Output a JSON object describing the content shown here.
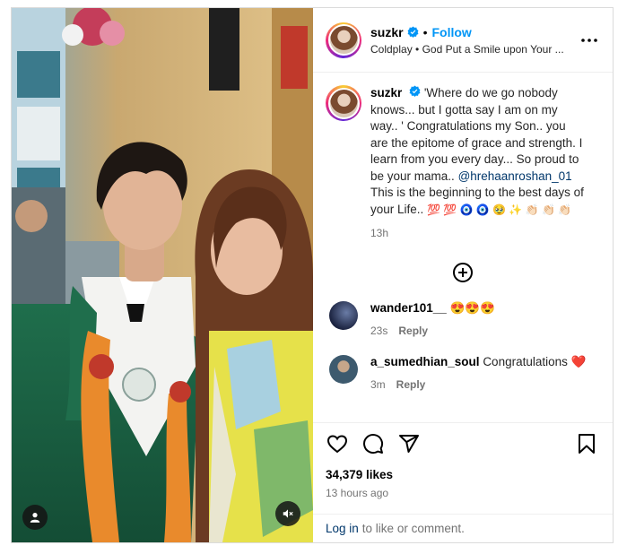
{
  "post": {
    "username": "suzkr",
    "follow_label": "Follow",
    "separator": "•",
    "audio": "Coldplay • God Put a Smile upon Your ...",
    "caption_text": "'Where do we go nobody knows... but I gotta say I am on my way.. ' Congratulations my Son.. you are the epitome of grace and strength. I learn from you every day... So proud to be your mama..",
    "mention": "@hrehaanroshan_01",
    "caption_tail": "This is the beginning to the best days of your Life..",
    "caption_emojis": "💯 💯 🧿 🧿 🥹 ✨ 👏🏻 👏🏻 👏🏻",
    "caption_time": "13h",
    "likes": "34,379 likes",
    "posted": "13 hours ago"
  },
  "comments": [
    {
      "username": "wander101__",
      "text": "😍😍😍",
      "time": "23s",
      "reply": "Reply"
    },
    {
      "username": "a_sumedhian_soul",
      "text": "Congratulations ❤️",
      "time": "3m",
      "reply": "Reply"
    }
  ],
  "footer": {
    "login_label": "Log in",
    "login_tail": "to like or comment."
  },
  "icons": {
    "verified": "verified-badge-icon",
    "more": "more-options-icon",
    "load_more": "load-more-comments-icon",
    "like": "heart-icon",
    "comment": "comment-icon",
    "share": "share-icon",
    "save": "bookmark-icon",
    "tagged": "user-tag-icon",
    "mute": "muted-speaker-icon"
  },
  "colors": {
    "accent": "#0095f6",
    "link": "#00376b",
    "verified": "#0095f6"
  }
}
